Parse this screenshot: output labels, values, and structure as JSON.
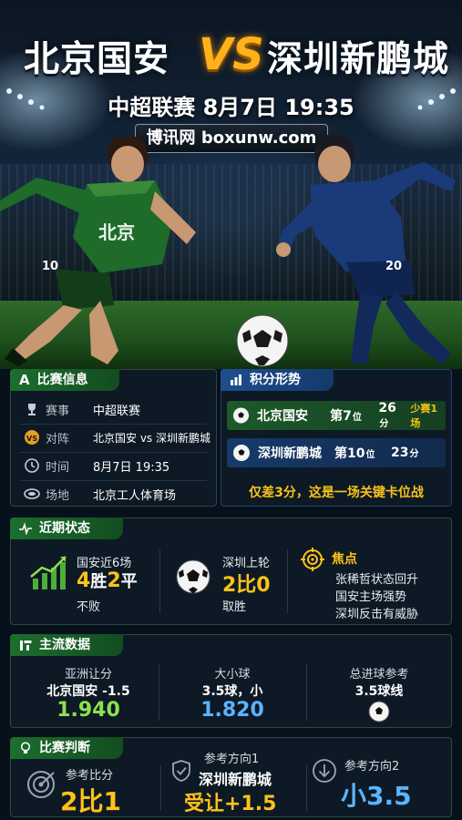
{
  "header": {
    "home_team": "北京国安",
    "vs": "VS",
    "away_team": "深圳新鹏城",
    "subtitle": "中超联赛  8月7日  19:35",
    "site": "博讯网 boxunw.com"
  },
  "players": {
    "home_jersey_text": "北京",
    "home_number": "10",
    "away_number": "20"
  },
  "match_info": {
    "tab": "比赛信息",
    "rows": [
      {
        "key": "赛事",
        "value": "中超联赛",
        "icon": "trophy-icon"
      },
      {
        "key": "对阵",
        "value": "北京国安 vs 深圳新鹏城",
        "icon": "vs-icon"
      },
      {
        "key": "时间",
        "value": "8月7日 19:35",
        "icon": "clock-icon"
      },
      {
        "key": "场地",
        "value": "北京工人体育场",
        "icon": "stadium-icon"
      }
    ]
  },
  "standings": {
    "tab": "积分形势",
    "rows": [
      {
        "team": "北京国安",
        "rank_prefix": "第",
        "rank": "7",
        "rank_unit": "位",
        "points": "26",
        "points_unit": "分",
        "extra": "少赛1场"
      },
      {
        "team": "深圳新鹏城",
        "rank_prefix": "第",
        "rank": "10",
        "rank_unit": "位",
        "points": "23",
        "points_unit": "分",
        "extra": ""
      }
    ],
    "note": "仅差3分，这是一场关键卡位战"
  },
  "recent_form": {
    "tab": "近期状态",
    "home_label": "国安近6场",
    "home_w": "4",
    "home_w_unit": "胜",
    "home_d": "2",
    "home_d_unit": "平",
    "home_sub": "不败",
    "away_label": "深圳上轮",
    "away_score": "2比0",
    "away_sub": "取胜",
    "focus_title": "焦点",
    "focus_lines": [
      "张稀哲状态回升",
      "国安主场强势",
      "深圳反击有威胁"
    ]
  },
  "odds": {
    "tab": "主流数据",
    "columns": [
      {
        "title": "亚洲让分",
        "sub": "北京国安 -1.5",
        "value": "1.940"
      },
      {
        "title": "大小球",
        "sub": "3.5球，小",
        "value": "1.820"
      },
      {
        "title": "总进球参考",
        "sub": "3.5球线",
        "value": ""
      }
    ]
  },
  "prediction": {
    "tab": "比赛判断",
    "score_label": "参考比分",
    "score": "2比1",
    "dir1_label": "参考方向1",
    "dir1_team": "深圳新鹏城",
    "dir1_value": "受让+1.5",
    "dir2_label": "参考方向2",
    "dir2_value": "小3.5"
  },
  "colors": {
    "accent_gold": "#ffc21a",
    "home_green": "#1c6e2e",
    "away_blue": "#1d4e8e",
    "odd_green": "#8ee04f",
    "odd_blue": "#5ab4ff"
  }
}
